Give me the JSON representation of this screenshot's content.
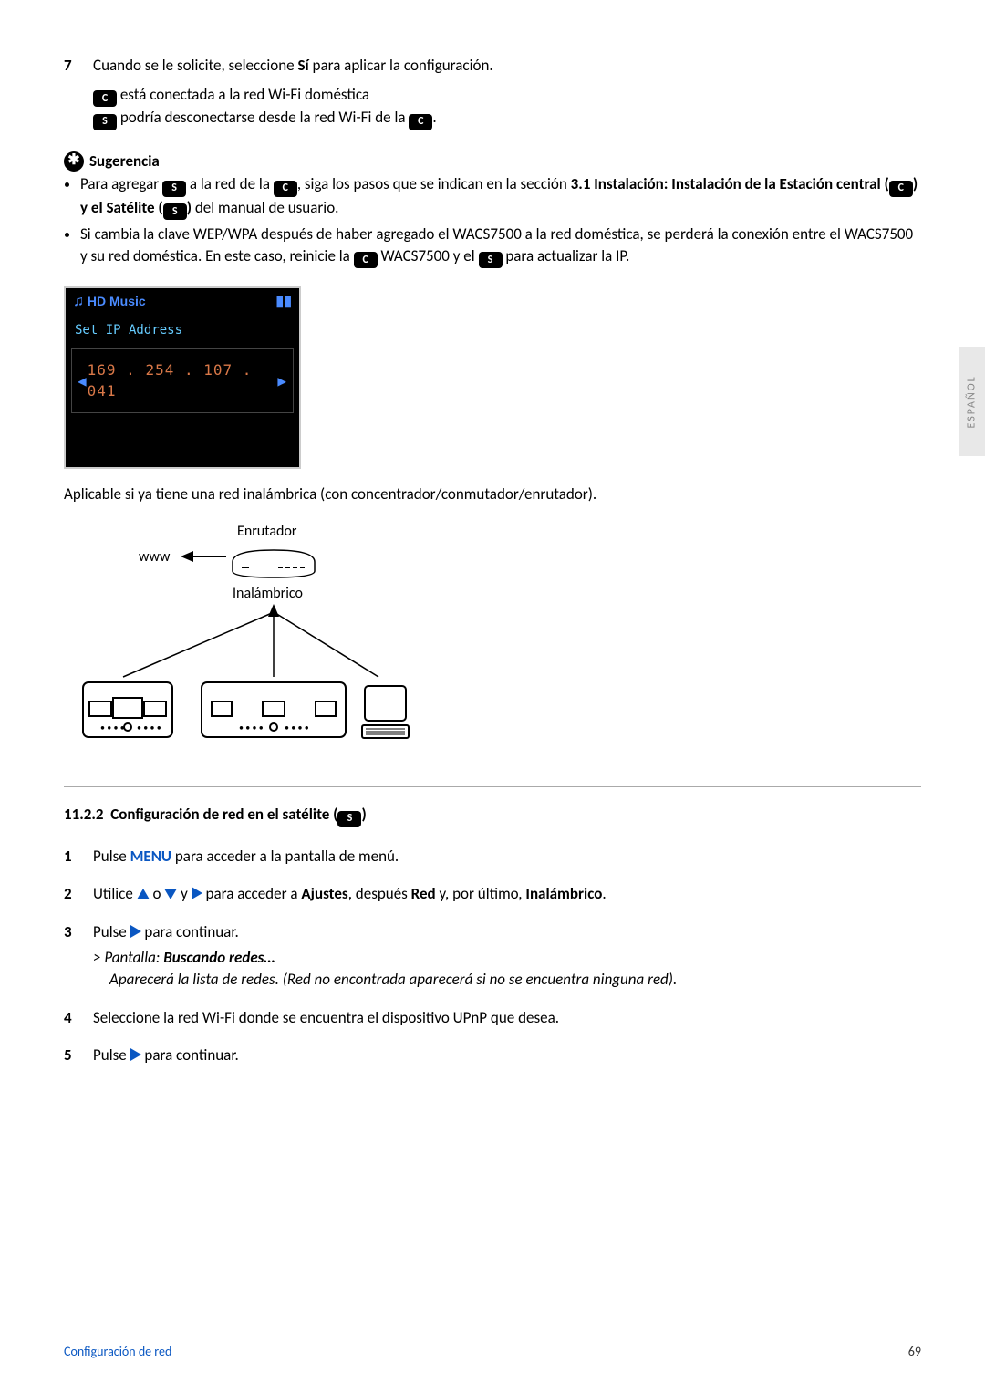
{
  "sideTab": "ESPAÑOL",
  "step7_num": "7",
  "step7_pre": "Cuando se le solicite, seleccione ",
  "step7_bold": "Sí",
  "step7_post": " para aplicar la configuración.",
  "center_line1": " está conectada a la red Wi-Fi doméstica",
  "center_line2_a": " podría desconectarse desde la red Wi-Fi de la ",
  "center_line2_b": ".",
  "tip_title": "Sugerencia",
  "tip1_a": "Para agregar ",
  "tip1_b": " a la red de la ",
  "tip1_c": ", siga los pasos que se indican en la sección ",
  "tip1_bold1": "3.1 Instalación: Instalación de la Estación central (",
  "tip1_mid": ") y el Satélite (",
  "tip1_end": ")",
  "tip1_after": " del manual de usuario.",
  "tip2_a": "Si cambia la clave WEP/WPA después de haber agregado el WACS7500 a la red doméstica, se perderá la conexión entre el WACS7500 y su red doméstica. En este caso, reinicie la ",
  "tip2_b": " WACS7500 y el ",
  "tip2_c": " para actualizar la IP.",
  "screen_header": "HD Music",
  "screen_title": "Set IP Address",
  "ip_oct1": "169",
  "ip_oct2": "254",
  "ip_oct3": "107",
  "ip_oct4": "041",
  "applicable": "Aplicable si ya tiene una red inalámbrica (con concentrador/conmutador/enrutador).",
  "router_top": "Enrutador",
  "www_label": "www",
  "router_bottom": "Inalámbrico",
  "section_num": "11.2.2",
  "section_title_a": "Configuración de red en el satélite (",
  "section_title_b": ")",
  "s1_num": "1",
  "s1_a": "Pulse ",
  "s1_menu": "MENU",
  "s1_b": " para acceder a la pantalla de menú.",
  "s2_num": "2",
  "s2_a": "Utilice ",
  "s2_b": " o ",
  "s2_c": " y ",
  "s2_d": " para acceder a ",
  "s2_bold1": "Ajustes",
  "s2_e": ", después ",
  "s2_bold2": "Red",
  "s2_f": " y, por último, ",
  "s2_bold3": "Inalámbrico",
  "s2_g": ".",
  "s3_num": "3",
  "s3_a": "Pulse ",
  "s3_b": " para continuar.",
  "s3_res_pre": "> ",
  "s3_res1_a": "Pantalla: ",
  "s3_res1_b": "Buscando redes…",
  "s3_res2": "Aparecerá la lista de redes. (Red no encontrada aparecerá si no se encuentra ninguna red).",
  "s4_num": "4",
  "s4_text": "Seleccione la red Wi-Fi donde se encuentra el dispositivo UPnP que desea.",
  "s5_num": "5",
  "s5_a": "Pulse ",
  "s5_b": " para continuar.",
  "footer_left": "Configuración de red",
  "footer_right": "69",
  "icon_c": "C",
  "icon_s": "S"
}
